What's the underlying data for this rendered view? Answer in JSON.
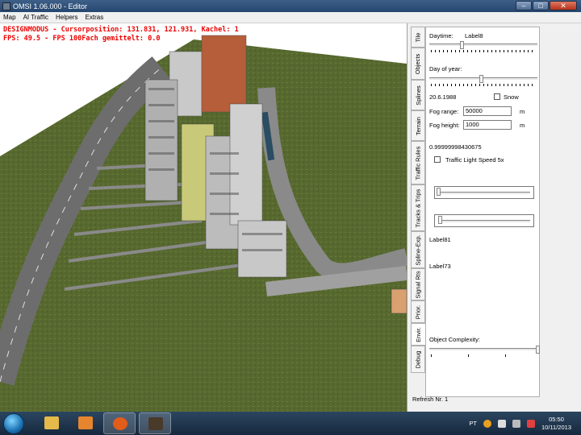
{
  "window": {
    "title": "OMSI 1.06.000 - Editor",
    "minimize": "–",
    "maximize": "□",
    "close": "✕"
  },
  "menu": [
    "Map",
    "AI Traffic",
    "Helpers",
    "Extras"
  ],
  "overlay": {
    "line1": "DESIGNMODUS - Cursorposition: 131.831, 121.931, Kachel: 1",
    "line2": "FPS: 49.5 - FPS 100Fach gemittelt: 0.0"
  },
  "tabs": [
    "Tile",
    "Objects",
    "Splines",
    "Terrain",
    "Traffic Rules",
    "Tracks & Trips",
    "Spline-Exp.",
    "Signal Rts",
    "Prior.",
    "Envir.",
    "Debug"
  ],
  "envir": {
    "daytime_label": "Daytime:",
    "daytime_value": "Label8",
    "day_of_year_label": "Day of year:",
    "date": "20.6.1988",
    "snow_label": "Snow",
    "fog_range_label": "Fog range:",
    "fog_range_value": "50000",
    "fog_height_label": "Fog height:",
    "fog_height_value": "1000",
    "unit_m": "m",
    "value_readout": "0.99999998430675",
    "traffic_light_label": "Traffic Light Speed 5x",
    "label81": "Label81",
    "label73": "Label73",
    "object_complexity_label": "Object Complexity:"
  },
  "status": "Refresh Nr. 1",
  "taskbar": {
    "language": "PT",
    "time": "05:50",
    "date": "10/11/2013"
  },
  "colors": {
    "overlay_text": "#e00000",
    "grass": "#55672e",
    "road": "#5f5f5f"
  }
}
